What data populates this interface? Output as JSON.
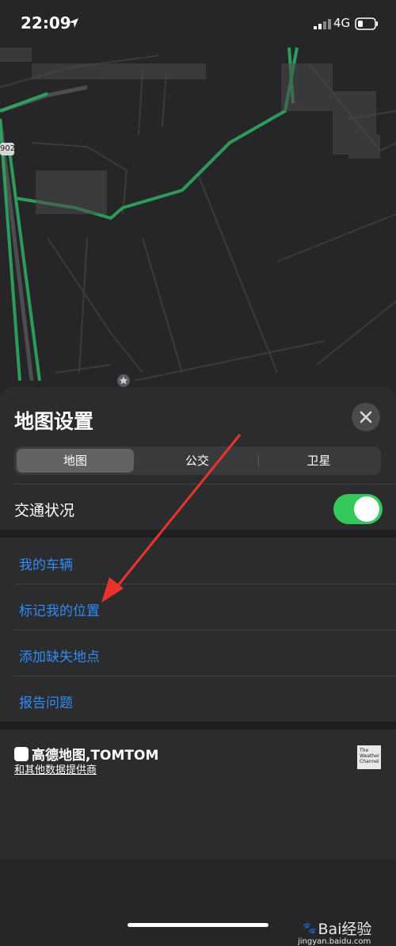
{
  "status_bar": {
    "time": "22:09",
    "network": "4G"
  },
  "map": {
    "road_badge": "902"
  },
  "sheet": {
    "title": "地图设置",
    "tabs": [
      {
        "label": "地图",
        "active": true
      },
      {
        "label": "公交",
        "active": false
      },
      {
        "label": "卫星",
        "active": false
      }
    ],
    "traffic": {
      "label": "交通状况",
      "enabled": true
    },
    "links": [
      {
        "label": "我的车辆"
      },
      {
        "label": "标记我的位置"
      },
      {
        "label": "添加缺失地点"
      },
      {
        "label": "报告问题"
      }
    ]
  },
  "footer": {
    "attribution_logo": "高德地图,TOMTOM",
    "attribution_link": "和其他数据提供商",
    "weather_logo": "The Weather Channel"
  },
  "watermark": {
    "brand": "Bai经验",
    "url": "jingyan.baidu.com"
  },
  "colors": {
    "accent_link": "#2f8cf5",
    "toggle_on": "#34c759",
    "sheet_bg": "#2c2c2e",
    "arrow": "#e8342d",
    "route": "#2ea85f"
  }
}
